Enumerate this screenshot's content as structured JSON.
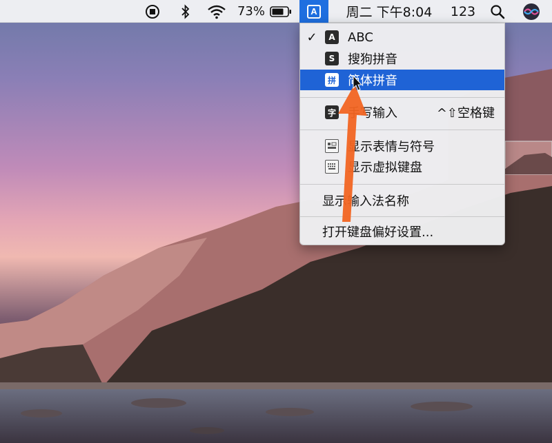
{
  "menubar": {
    "battery_percent": "73%",
    "input_source_letter": "A",
    "clock": "周二 下午8:04",
    "keyboard_mode": "123",
    "icons": [
      "screen-record-icon",
      "bluetooth-icon",
      "wifi-icon",
      "battery-icon",
      "input-source-icon",
      "spotlight-search-icon",
      "siri-icon"
    ]
  },
  "input_menu": {
    "items": [
      {
        "label": "ABC",
        "icon_letter": "A",
        "checked": true,
        "check_mark": "✓"
      },
      {
        "label": "搜狗拼音",
        "icon_letter": "S"
      },
      {
        "label": "简体拼音",
        "icon_letter": "拼",
        "highlighted": true
      },
      {
        "label": "手写输入",
        "icon_letter": "字",
        "shortcut": "^⇧空格键"
      },
      {
        "label": "显示表情与符号",
        "icon": "emoji-symbols-icon"
      },
      {
        "label": "显示虚拟键盘",
        "icon": "virtual-keyboard-icon"
      },
      {
        "label": "显示输入法名称"
      },
      {
        "label": "打开键盘偏好设置..."
      }
    ]
  },
  "colors": {
    "highlight": "#1f63d6",
    "annotation_arrow": "#f26522"
  }
}
